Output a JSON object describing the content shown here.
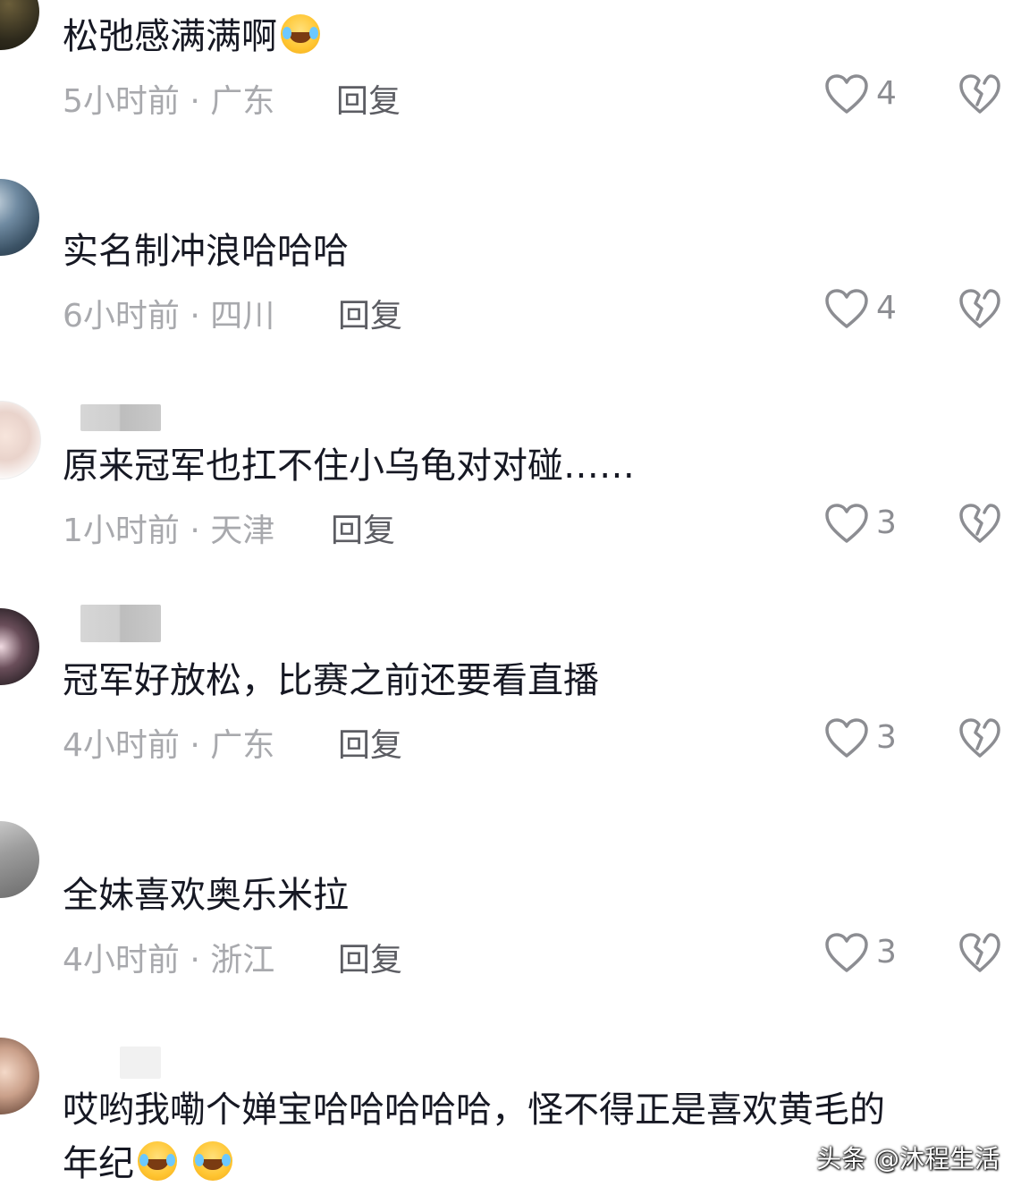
{
  "comments": [
    {
      "text": "松弛感满满啊",
      "time": "5小时前",
      "region": "广东",
      "reply_label": "回复",
      "likes": "4",
      "emoji_count": 1
    },
    {
      "text": "实名制冲浪哈哈哈",
      "time": "6小时前",
      "region": "四川",
      "reply_label": "回复",
      "likes": "4",
      "emoji_count": 0
    },
    {
      "text": "原来冠军也扛不住小乌龟对对碰……",
      "time": "1小时前",
      "region": "天津",
      "reply_label": "回复",
      "likes": "3",
      "emoji_count": 0
    },
    {
      "text": "冠军好放松，比赛之前还要看直播",
      "time": "4小时前",
      "region": "广东",
      "reply_label": "回复",
      "likes": "3",
      "emoji_count": 0
    },
    {
      "text": "全妹喜欢奥乐米拉",
      "time": "4小时前",
      "region": "浙江",
      "reply_label": "回复",
      "likes": "3",
      "emoji_count": 0
    },
    {
      "text": "哎哟我嘞个婵宝哈哈哈哈哈，怪不得正是喜欢黄毛的",
      "text2": "年纪",
      "emoji_count": 2
    }
  ],
  "separator": "·",
  "watermark": "头条 @沐程生活",
  "icons": {
    "like": "heart-outline-icon",
    "dislike": "broken-heart-icon",
    "emoji": "laugh-cry-emoji"
  },
  "colors": {
    "text": "#161823",
    "meta": "#a8a9ad",
    "reply": "#5c5d63",
    "icon": "#8c8d92"
  }
}
